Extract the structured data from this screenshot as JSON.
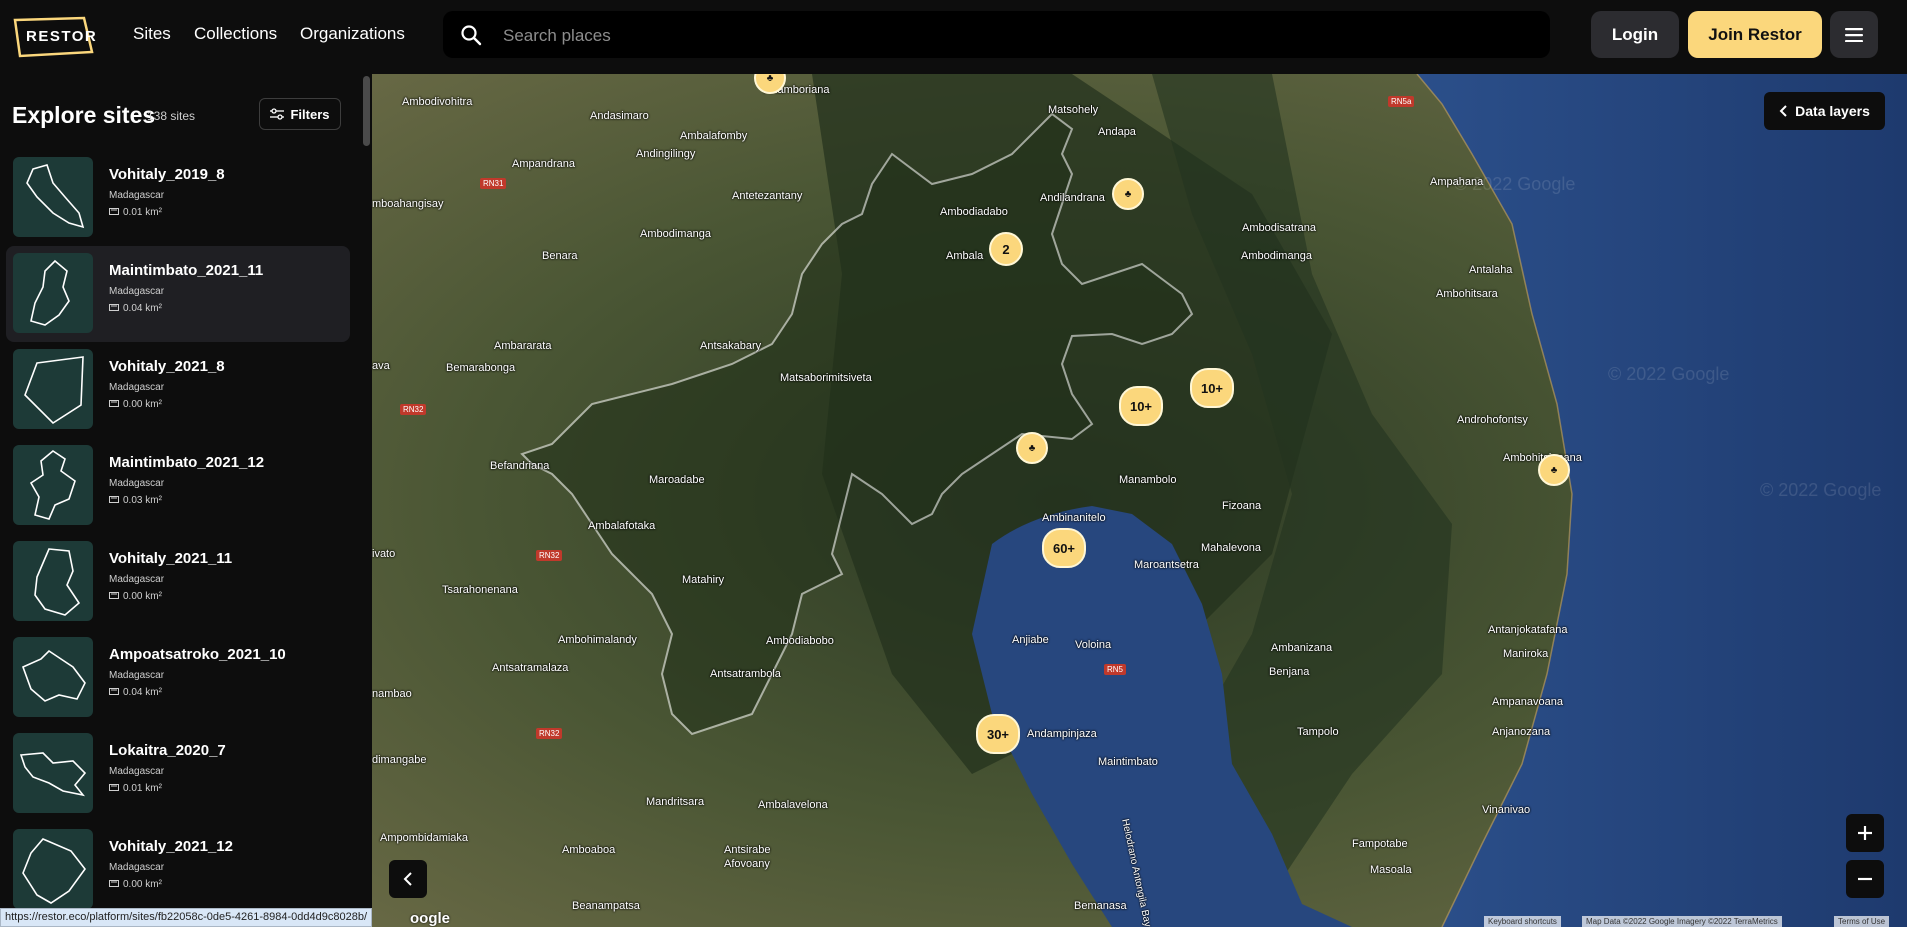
{
  "header": {
    "logo_text": "RESTOR",
    "nav": [
      "Sites",
      "Collections",
      "Organizations"
    ],
    "search_placeholder": "Search places",
    "login": "Login",
    "join": "Join Restor"
  },
  "sidebar": {
    "title": "Explore sites",
    "count": "138 sites",
    "filters": "Filters",
    "sites": [
      {
        "name": "Vohitaly_2019_8",
        "country": "Madagascar",
        "area": "0.01 km²"
      },
      {
        "name": "Maintimbato_2021_11",
        "country": "Madagascar",
        "area": "0.04 km²",
        "selected": true
      },
      {
        "name": "Vohitaly_2021_8",
        "country": "Madagascar",
        "area": "0.00 km²"
      },
      {
        "name": "Maintimbato_2021_12",
        "country": "Madagascar",
        "area": "0.03 km²"
      },
      {
        "name": "Vohitaly_2021_11",
        "country": "Madagascar",
        "area": "0.00 km²"
      },
      {
        "name": "Ampoatsatroko_2021_10",
        "country": "Madagascar",
        "area": "0.04 km²"
      },
      {
        "name": "Lokaitra_2020_7",
        "country": "Madagascar",
        "area": "0.01 km²"
      },
      {
        "name": "Vohitaly_2021_12",
        "country": "Madagascar",
        "area": "0.00 km²"
      }
    ]
  },
  "status_url": "https://restor.eco/platform/sites/fb22058c-0de5-4261-8984-0dd4d9c8028b/",
  "map": {
    "data_layers": "Data layers",
    "clusters": [
      "2",
      "10+",
      "10+",
      "60+",
      "30+"
    ],
    "places": [
      "Anamboriana",
      "Ambodivohitra",
      "Andasimaro",
      "Ambalafomby",
      "Matsohely",
      "Andapa",
      "Ampandrana",
      "Andingilingy",
      "Antetezantany",
      "Ambodiadabo",
      "Andilandrana",
      "Ampahana",
      "Ambodisatrana",
      "Antalaha",
      "Ambohitsara",
      "Ambodimanga",
      "Ambodimanga",
      "Benara",
      "Ambala",
      "Ambararata",
      "Antsakabary",
      "Matsaborimitsiveta",
      "Bemarabonga",
      "Androhofontsy",
      "Ambohitsianana",
      "Befandriana",
      "Maroadabe",
      "Manambolo",
      "Ambinanitelo",
      "Fizoana",
      "Mahalevona",
      "Ambalafotaka",
      "Maroantsetra",
      "Tsarahonenana",
      "Matahiry",
      "Ambohimalandy",
      "Ambodiabobo",
      "Antsatramalaza",
      "Antsatrambola",
      "Anjiabe",
      "Voloina",
      "Ambanizana",
      "Benjana",
      "Antanjokatafana",
      "Maniroka",
      "Ampanavoana",
      "Anjanozana",
      "Tampolo",
      "Andampinjaza",
      "Maintimbato",
      "Mandritsara",
      "Ambalavelona",
      "Vinanivao",
      "Fampotabe",
      "Masoala",
      "Ampombidamiaka",
      "Amboaboa",
      "Antsirabe",
      "Afovoany",
      "Beanampatsa",
      "Bemanasa",
      "mboahangisay",
      "ava",
      "ivato",
      "nambao",
      "dimangabe",
      "Helodrano Antongila Bay"
    ],
    "roads": [
      "RN5a",
      "RN31",
      "RN32",
      "RN32",
      "RN32",
      "RN5"
    ],
    "watermarks": [
      "© 2022 Google",
      "© 2022 Google",
      "© 2022 Google"
    ],
    "attribution": [
      "Keyboard shortcuts",
      "Map Data ©2022 Google Imagery ©2022 TerraMetrics",
      "Terms of Use"
    ],
    "google_logo": "oogle"
  },
  "icons": {
    "search": "search-icon",
    "menu": "hamburger-menu-icon",
    "filters": "sliders-icon",
    "area": "ruler-icon",
    "collapse": "chevron-left-icon",
    "zoom_in": "plus-icon",
    "zoom_out": "minus-icon",
    "pin": "tree-marker-icon"
  },
  "colors": {
    "accent": "#fbd77c",
    "background": "#0d0d0d",
    "thumb": "#1d3a37"
  }
}
